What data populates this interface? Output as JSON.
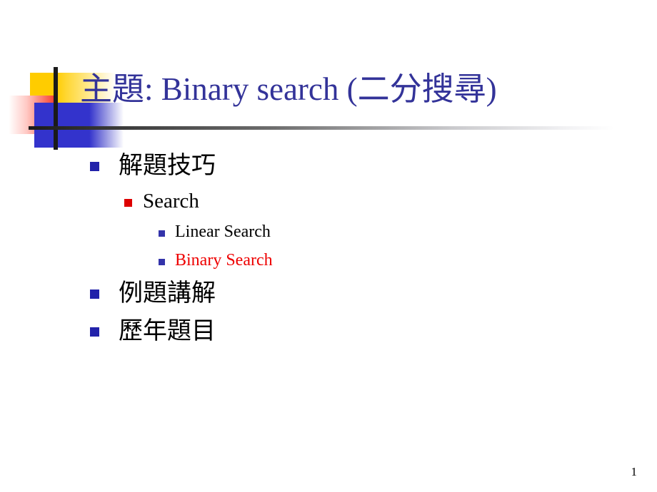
{
  "slide": {
    "title": "主題: Binary search (二分搜尋)",
    "page_number": "1",
    "colors": {
      "title_blue": "#333399",
      "deco_yellow": "#ffcc00",
      "deco_blue": "#3333cc",
      "deco_red": "#ef2010",
      "deco_bar_black": "#1a1a1a",
      "bullet_level1": "#2222aa",
      "bullet_level2": "#dd0000",
      "bullet_level3": "#3333aa",
      "text_black": "#000000",
      "text_red": "#ee0000"
    },
    "outline": [
      {
        "level": 1,
        "label": "解題技巧",
        "color": "#000000",
        "bullet": "square-bullet-blue"
      },
      {
        "level": 2,
        "label": "Search",
        "color": "#000000",
        "bullet": "square-bullet-red"
      },
      {
        "level": 3,
        "label": "Linear Search",
        "color": "#000000",
        "bullet": "square-bullet-blue-small"
      },
      {
        "level": 3,
        "label": "Binary Search",
        "color": "#ee0000",
        "bullet": "square-bullet-blue-small"
      },
      {
        "level": 1,
        "label": "例題講解",
        "color": "#000000",
        "bullet": "square-bullet-blue"
      },
      {
        "level": 1,
        "label": "歷年題目",
        "color": "#000000",
        "bullet": "square-bullet-blue"
      }
    ]
  }
}
